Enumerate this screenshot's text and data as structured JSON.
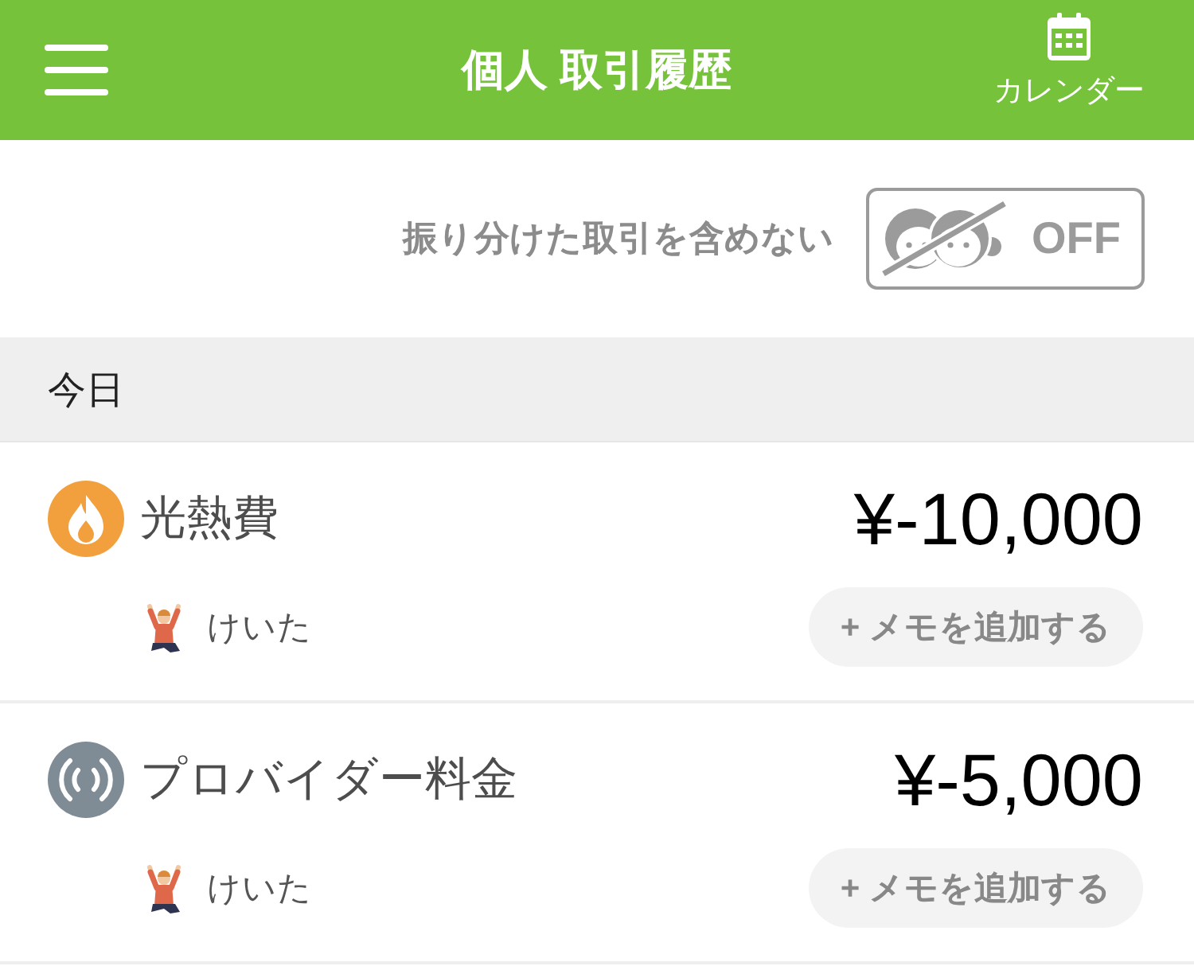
{
  "header": {
    "title": "個人 取引履歴",
    "calendar_label": "カレンダー"
  },
  "filter": {
    "label": "振り分けた取引を含めない",
    "toggle": {
      "text": "OFF",
      "on": false
    }
  },
  "sections": [
    {
      "heading": "今日",
      "transactions": [
        {
          "kind": "utilities",
          "color": "#f2a03d",
          "category": "光熱費",
          "amount": "¥-10,000",
          "member": "けいた",
          "memo_button": "+ メモを追加する"
        },
        {
          "kind": "internet",
          "color": "#7f8c96",
          "category": "プロバイダー料金",
          "amount": "¥-5,000",
          "member": "けいた",
          "memo_button": "+ メモを追加する"
        }
      ]
    }
  ]
}
